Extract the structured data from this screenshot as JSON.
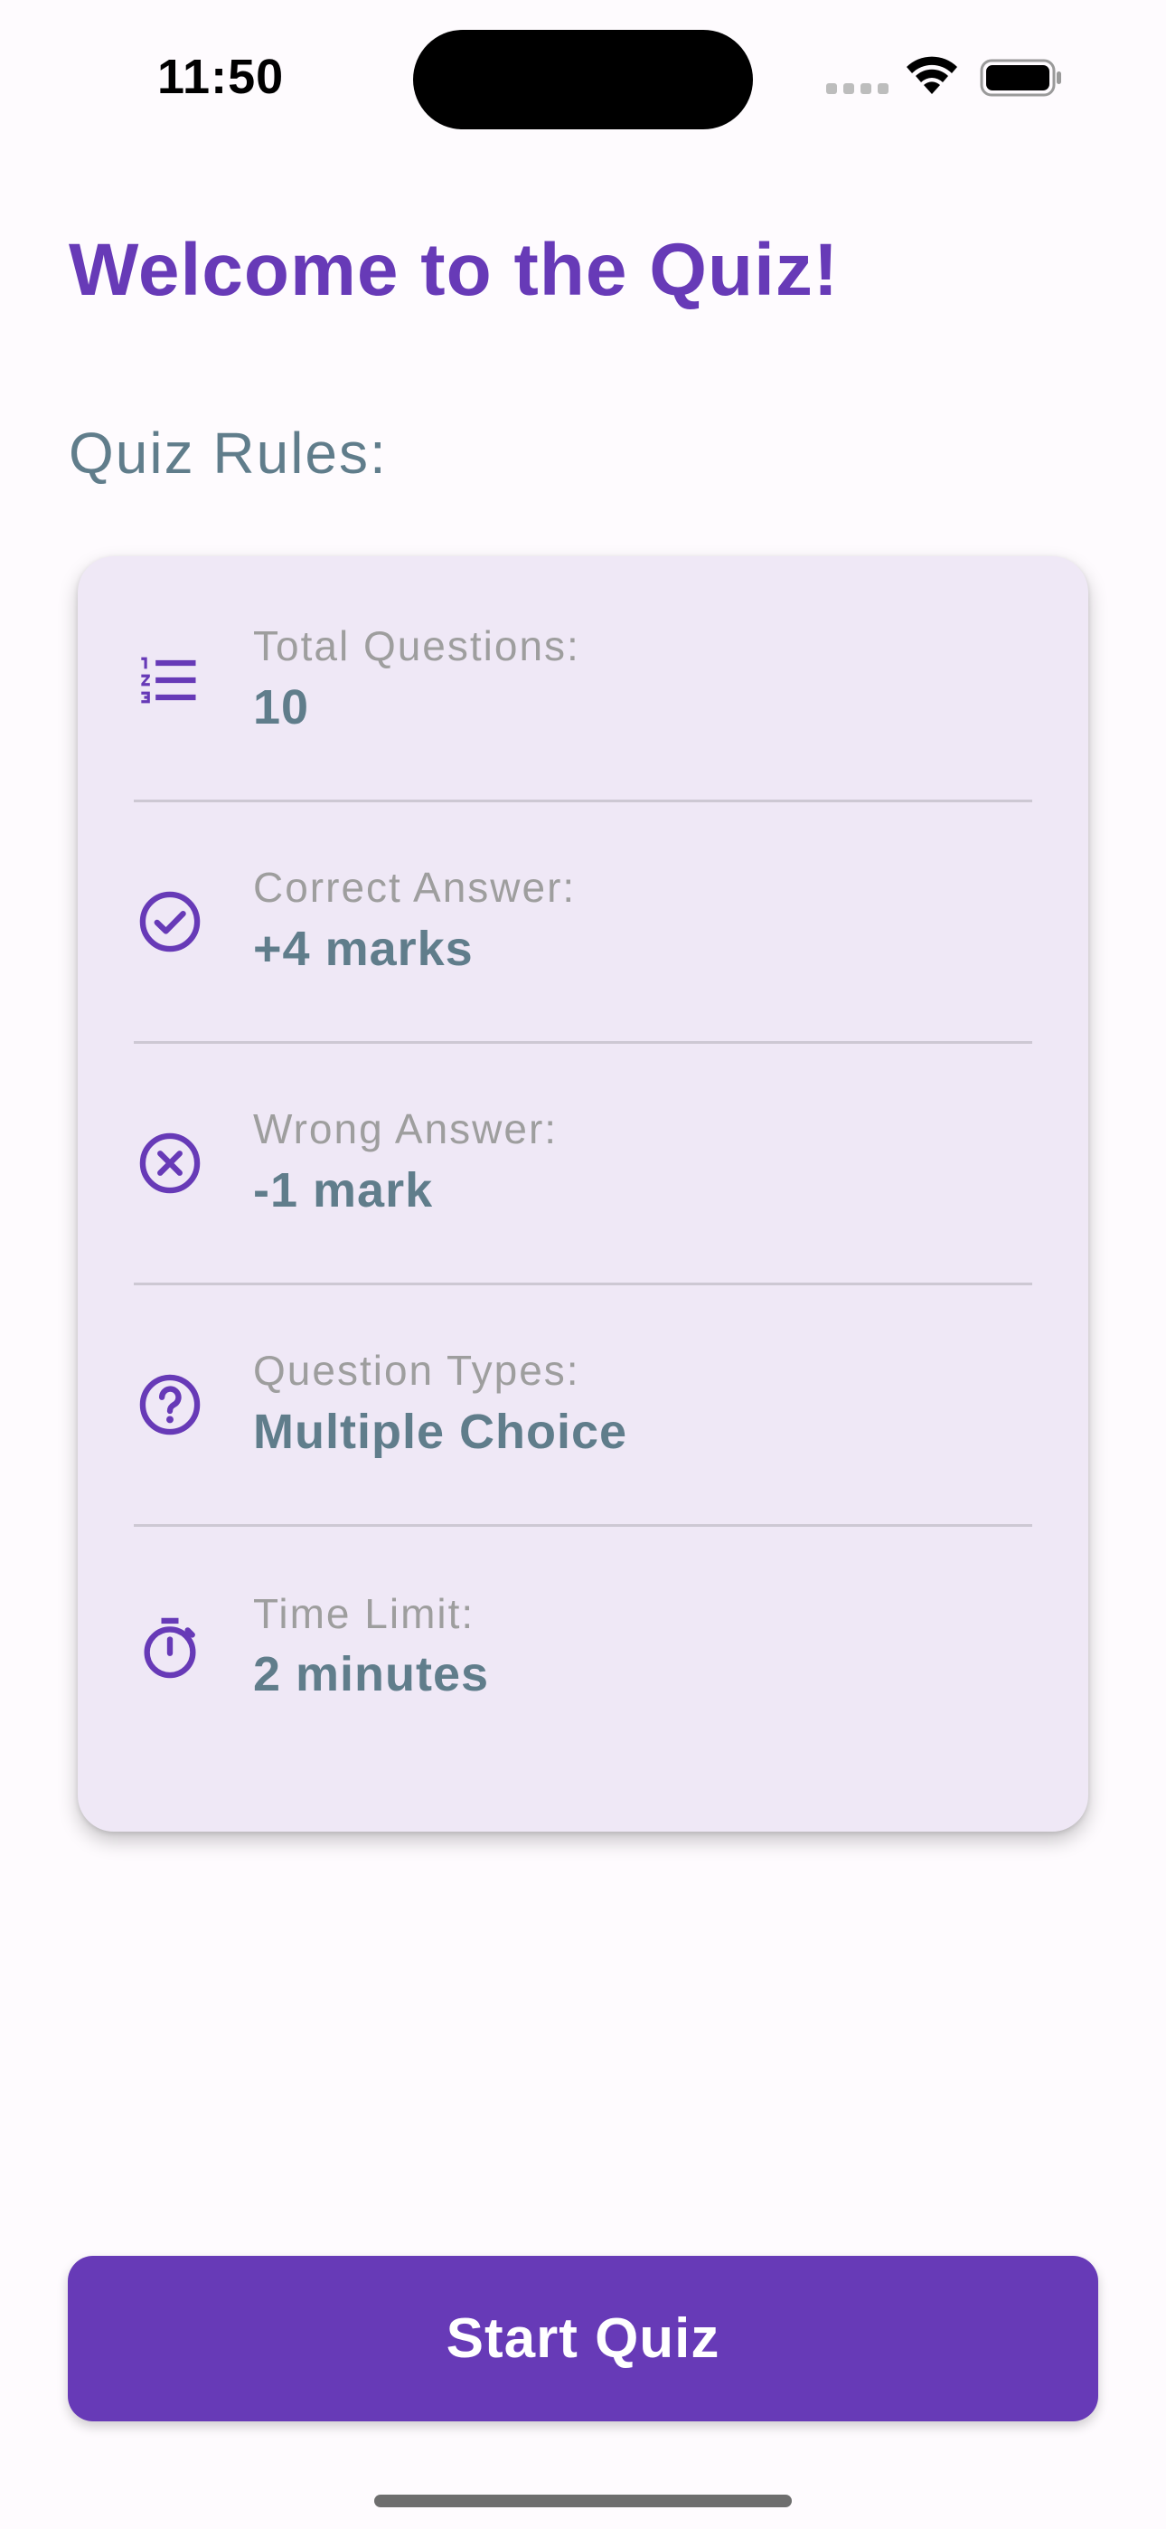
{
  "status_bar": {
    "time": "11:50",
    "wifi_icon": "wifi-icon",
    "battery_icon": "battery-full-icon",
    "signal_icon": "signal-dots-icon"
  },
  "page": {
    "title": "Welcome to the Quiz!",
    "rules_heading": "Quiz Rules:"
  },
  "rules": [
    {
      "icon": "numbered-list-icon",
      "label": "Total Questions:",
      "value": "10"
    },
    {
      "icon": "check-circle-icon",
      "label": "Correct Answer:",
      "value": "+4 marks"
    },
    {
      "icon": "cancel-circle-icon",
      "label": "Wrong Answer:",
      "value": "-1 mark"
    },
    {
      "icon": "help-circle-icon",
      "label": "Question Types:",
      "value": "Multiple Choice"
    },
    {
      "icon": "timer-icon",
      "label": "Time Limit:",
      "value": "2 minutes"
    }
  ],
  "actions": {
    "start_label": "Start Quiz"
  },
  "colors": {
    "primary": "#673ab7",
    "card_background": "#efe8f6",
    "secondary_text": "#607d8b",
    "label_text": "#9e9e9e",
    "page_background": "#fefbfe"
  }
}
